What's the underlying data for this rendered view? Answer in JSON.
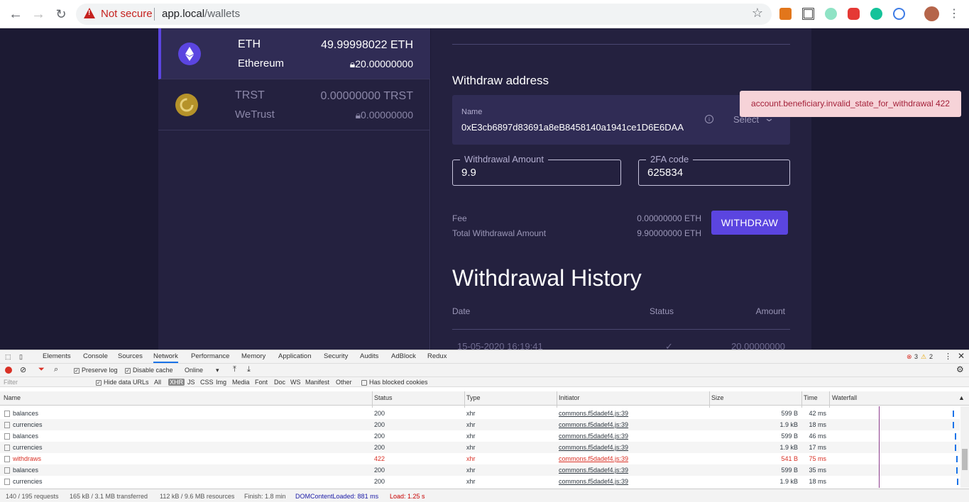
{
  "browser": {
    "security_label": "Not secure",
    "url_host": "app.local",
    "url_path": "/wallets"
  },
  "wallets": [
    {
      "symbol": "ETH",
      "name": "Ethereum",
      "balance": "49.99998022 ETH",
      "locked": "20.00000000",
      "icon": "ethereum-icon"
    },
    {
      "symbol": "TRST",
      "name": "WeTrust",
      "balance": "0.00000000 TRST",
      "locked": "0.00000000",
      "icon": "wetrust-icon"
    }
  ],
  "withdraw": {
    "section_title": "Withdraw address",
    "address_label": "Name",
    "address_value": "0xE3cb6897d83691a8eB8458140a1941ce1D6E6DAA",
    "select_label": "Select",
    "amount_label": "Withdrawal Amount",
    "amount_value": "9.9",
    "twofa_label": "2FA code",
    "twofa_value": "625834",
    "fee_label": "Fee",
    "fee_value": "0.00000000 ETH",
    "total_label": "Total Withdrawal Amount",
    "total_value": "9.90000000 ETH",
    "button": "WITHDRAW"
  },
  "history": {
    "title": "Withdrawal History",
    "col_date": "Date",
    "col_status": "Status",
    "col_amount": "Amount",
    "rows": [
      {
        "date": "15-05-2020 16:19:41",
        "status": "✓",
        "amount": "20.00000000"
      }
    ]
  },
  "toast": "account.beneficiary.invalid_state_for_withdrawal 422",
  "devtools": {
    "tabs": [
      "Elements",
      "Console",
      "Sources",
      "Network",
      "Performance",
      "Memory",
      "Application",
      "Security",
      "Audits",
      "AdBlock",
      "Redux"
    ],
    "active_tab": "Network",
    "errors": "3",
    "warnings": "2",
    "preserve_log": "Preserve log",
    "disable_cache": "Disable cache",
    "throttle": "Online",
    "filter_placeholder": "Filter",
    "hide_data_urls": "Hide data URLs",
    "filter_types": [
      "All",
      "XHR",
      "JS",
      "CSS",
      "Img",
      "Media",
      "Font",
      "Doc",
      "WS",
      "Manifest",
      "Other"
    ],
    "active_filter": "XHR",
    "blocked_cookies": "Has blocked cookies",
    "columns": [
      "Name",
      "Status",
      "Type",
      "Initiator",
      "Size",
      "Time",
      "Waterfall"
    ],
    "requests": [
      {
        "name": "balances",
        "status": "200",
        "type": "xhr",
        "initiator": "commons.f5dadef4.js:39",
        "size": "599 B",
        "time": "42 ms",
        "error": false
      },
      {
        "name": "currencies",
        "status": "200",
        "type": "xhr",
        "initiator": "commons.f5dadef4.js:39",
        "size": "1.9 kB",
        "time": "18 ms",
        "error": false
      },
      {
        "name": "balances",
        "status": "200",
        "type": "xhr",
        "initiator": "commons.f5dadef4.js:39",
        "size": "599 B",
        "time": "46 ms",
        "error": false
      },
      {
        "name": "currencies",
        "status": "200",
        "type": "xhr",
        "initiator": "commons.f5dadef4.js:39",
        "size": "1.9 kB",
        "time": "17 ms",
        "error": false
      },
      {
        "name": "withdraws",
        "status": "422",
        "type": "xhr",
        "initiator": "commons.f5dadef4.js:39",
        "size": "541 B",
        "time": "75 ms",
        "error": true
      },
      {
        "name": "balances",
        "status": "200",
        "type": "xhr",
        "initiator": "commons.f5dadef4.js:39",
        "size": "599 B",
        "time": "35 ms",
        "error": false
      },
      {
        "name": "currencies",
        "status": "200",
        "type": "xhr",
        "initiator": "commons.f5dadef4.js:39",
        "size": "1.9 kB",
        "time": "18 ms",
        "error": false
      }
    ],
    "summary": {
      "requests": "140 / 195 requests",
      "transferred": "165 kB / 3.1 MB transferred",
      "resources": "112 kB / 9.6 MB resources",
      "finish": "Finish: 1.8 min",
      "dcl": "DOMContentLoaded: 881 ms",
      "load": "Load: 1.25 s"
    }
  },
  "colors": {
    "accent": "#5b45e0",
    "bg": "#1c1a33",
    "panel": "#24213f",
    "error": "#d93025",
    "toast_bg": "#f6d3d8"
  }
}
